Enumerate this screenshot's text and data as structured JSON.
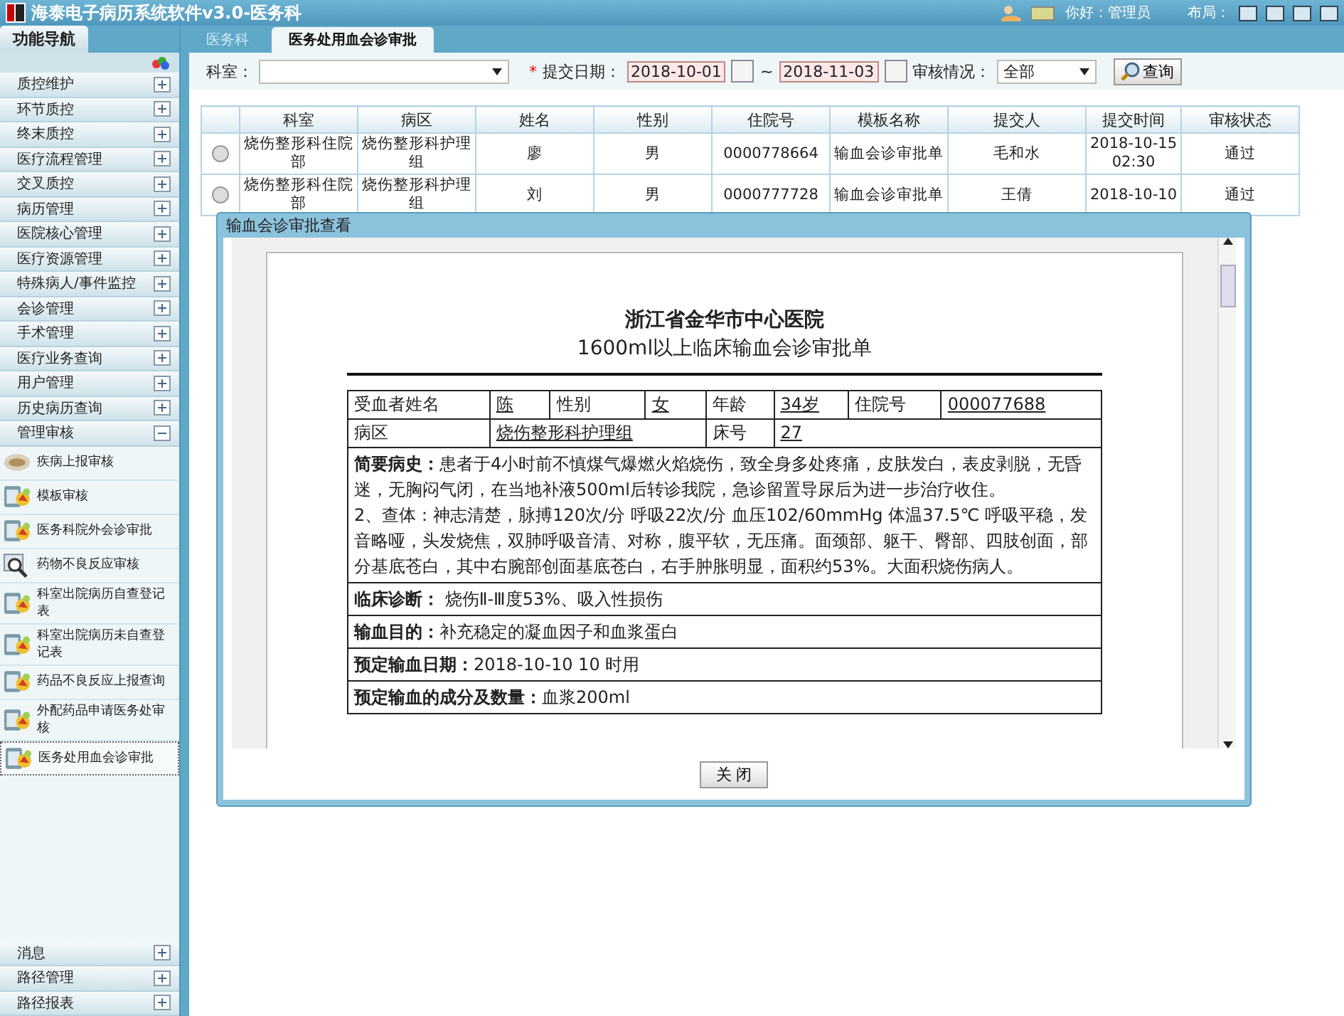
{
  "app": {
    "title": "海泰电子病历系统软件v3.0-医务科",
    "greeting": "你好：管理员",
    "layout_label": "布局："
  },
  "sidebar": {
    "title": "功能导航",
    "groups": [
      {
        "label": "质控维护",
        "expanded": false
      },
      {
        "label": "环节质控",
        "expanded": false
      },
      {
        "label": "终末质控",
        "expanded": false
      },
      {
        "label": "医疗流程管理",
        "expanded": false
      },
      {
        "label": "交叉质控",
        "expanded": false
      },
      {
        "label": "病历管理",
        "expanded": false
      },
      {
        "label": "医院核心管理",
        "expanded": false
      },
      {
        "label": "医疗资源管理",
        "expanded": false
      },
      {
        "label": "特殊病人/事件监控",
        "expanded": false
      },
      {
        "label": "会诊管理",
        "expanded": false
      },
      {
        "label": "手术管理",
        "expanded": false
      },
      {
        "label": "医疗业务查询",
        "expanded": false
      },
      {
        "label": "用户管理",
        "expanded": false
      },
      {
        "label": "历史病历查询",
        "expanded": false
      },
      {
        "label": "管理审核",
        "expanded": true,
        "children": [
          {
            "label": "疾病上报审核",
            "kind": "bubble",
            "selected": false
          },
          {
            "label": "模板审核",
            "kind": "kit",
            "selected": false
          },
          {
            "label": "医务科院外会诊审批",
            "kind": "kit",
            "selected": false
          },
          {
            "label": "药物不良反应审核",
            "kind": "search",
            "selected": false
          },
          {
            "label": "科室出院病历自查登记表",
            "kind": "kit",
            "selected": false
          },
          {
            "label": "科室出院病历未自查登记表",
            "kind": "kit",
            "selected": false
          },
          {
            "label": "药品不良反应上报查询",
            "kind": "kit",
            "selected": false
          },
          {
            "label": "外配药品申请医务处审核",
            "kind": "kit",
            "selected": false
          },
          {
            "label": "医务处用血会诊审批",
            "kind": "kit",
            "selected": true
          }
        ]
      }
    ],
    "bottom_groups": [
      {
        "label": "消息",
        "expanded": false
      },
      {
        "label": "路径管理",
        "expanded": false
      },
      {
        "label": "路径报表",
        "expanded": false
      }
    ]
  },
  "tabs": [
    {
      "label": "医务科",
      "selected": false
    },
    {
      "label": "医务处用血会诊审批",
      "selected": true
    }
  ],
  "filters": {
    "dept_label": "科室：",
    "required_mark": "*",
    "date_label": "提交日期：",
    "date_from": "2018-10-01",
    "date_sep": "~",
    "date_to": "2018-11-03",
    "status_label": "审核情况：",
    "status_value": "全部",
    "query_button": "查询"
  },
  "table": {
    "columns": [
      "科室",
      "病区",
      "姓名",
      "性别",
      "住院号",
      "模板名称",
      "提交人",
      "提交时间",
      "审核状态"
    ],
    "rows": [
      {
        "selected": false,
        "cells": [
          "烧伤整形科住院部",
          "烧伤整形科护理组",
          "廖",
          "男",
          "0000778664",
          "输血会诊审批单",
          "毛和水",
          "2018-10-15 02:30",
          "通过"
        ]
      },
      {
        "selected": false,
        "cells": [
          "烧伤整形科住院部",
          "烧伤整形科护理组",
          "刘",
          "男",
          "0000777728",
          "输血会诊审批单",
          "王倩",
          "2018-10-10",
          "通过"
        ]
      }
    ]
  },
  "dialog": {
    "title": "输血会诊审批查看",
    "close_button": "关 闭",
    "document": {
      "hospital": "浙江省金华市中心医院",
      "form_title": "1600ml以上临床输血会诊审批单",
      "info_rows": [
        [
          {
            "label": "受血者姓名"
          },
          {
            "value": "陈"
          },
          {
            "label": "性别"
          },
          {
            "value": "女"
          },
          {
            "label": "年龄"
          },
          {
            "value": "34岁"
          },
          {
            "label": "住院号"
          },
          {
            "value": "000077688"
          }
        ],
        [
          {
            "label": "病区"
          },
          {
            "value": "烧伤整形科护理组"
          },
          {
            "label": "床号"
          },
          {
            "value": "27"
          }
        ]
      ],
      "sections": [
        [
          "**简要病史：**患者于4小时前不慎煤气爆燃火焰烧伤，致全身多处疼痛，皮肤发白，表皮剥脱，无昏迷，无胸闷气闭，在当地补液500ml后转诊我院，急诊留置导尿后为进一步治疗收住。",
          "2、查体：神志清楚，脉搏120次/分 呼吸22次/分 血压102/60mmHg 体温37.5℃ 呼吸平稳，发音略哑，头发烧焦，双肺呼吸音清、对称，腹平软，无压痛。面颈部、躯干、臀部、四肢创面，部分基底苍白，其中右腕部创面基底苍白，右手肿胀明显，面积约53%。大面积烧伤病人。"
        ],
        [
          "**临床诊断：** 烧伤Ⅱ-Ⅲ度53%、吸入性损伤"
        ],
        [
          "**输血目的：**补充稳定的凝血因子和血浆蛋白"
        ],
        [
          "**预定输血日期：**2018-10-10 10 时用"
        ],
        [
          "**预定输血的成分及数量：**血浆200ml"
        ]
      ]
    }
  }
}
